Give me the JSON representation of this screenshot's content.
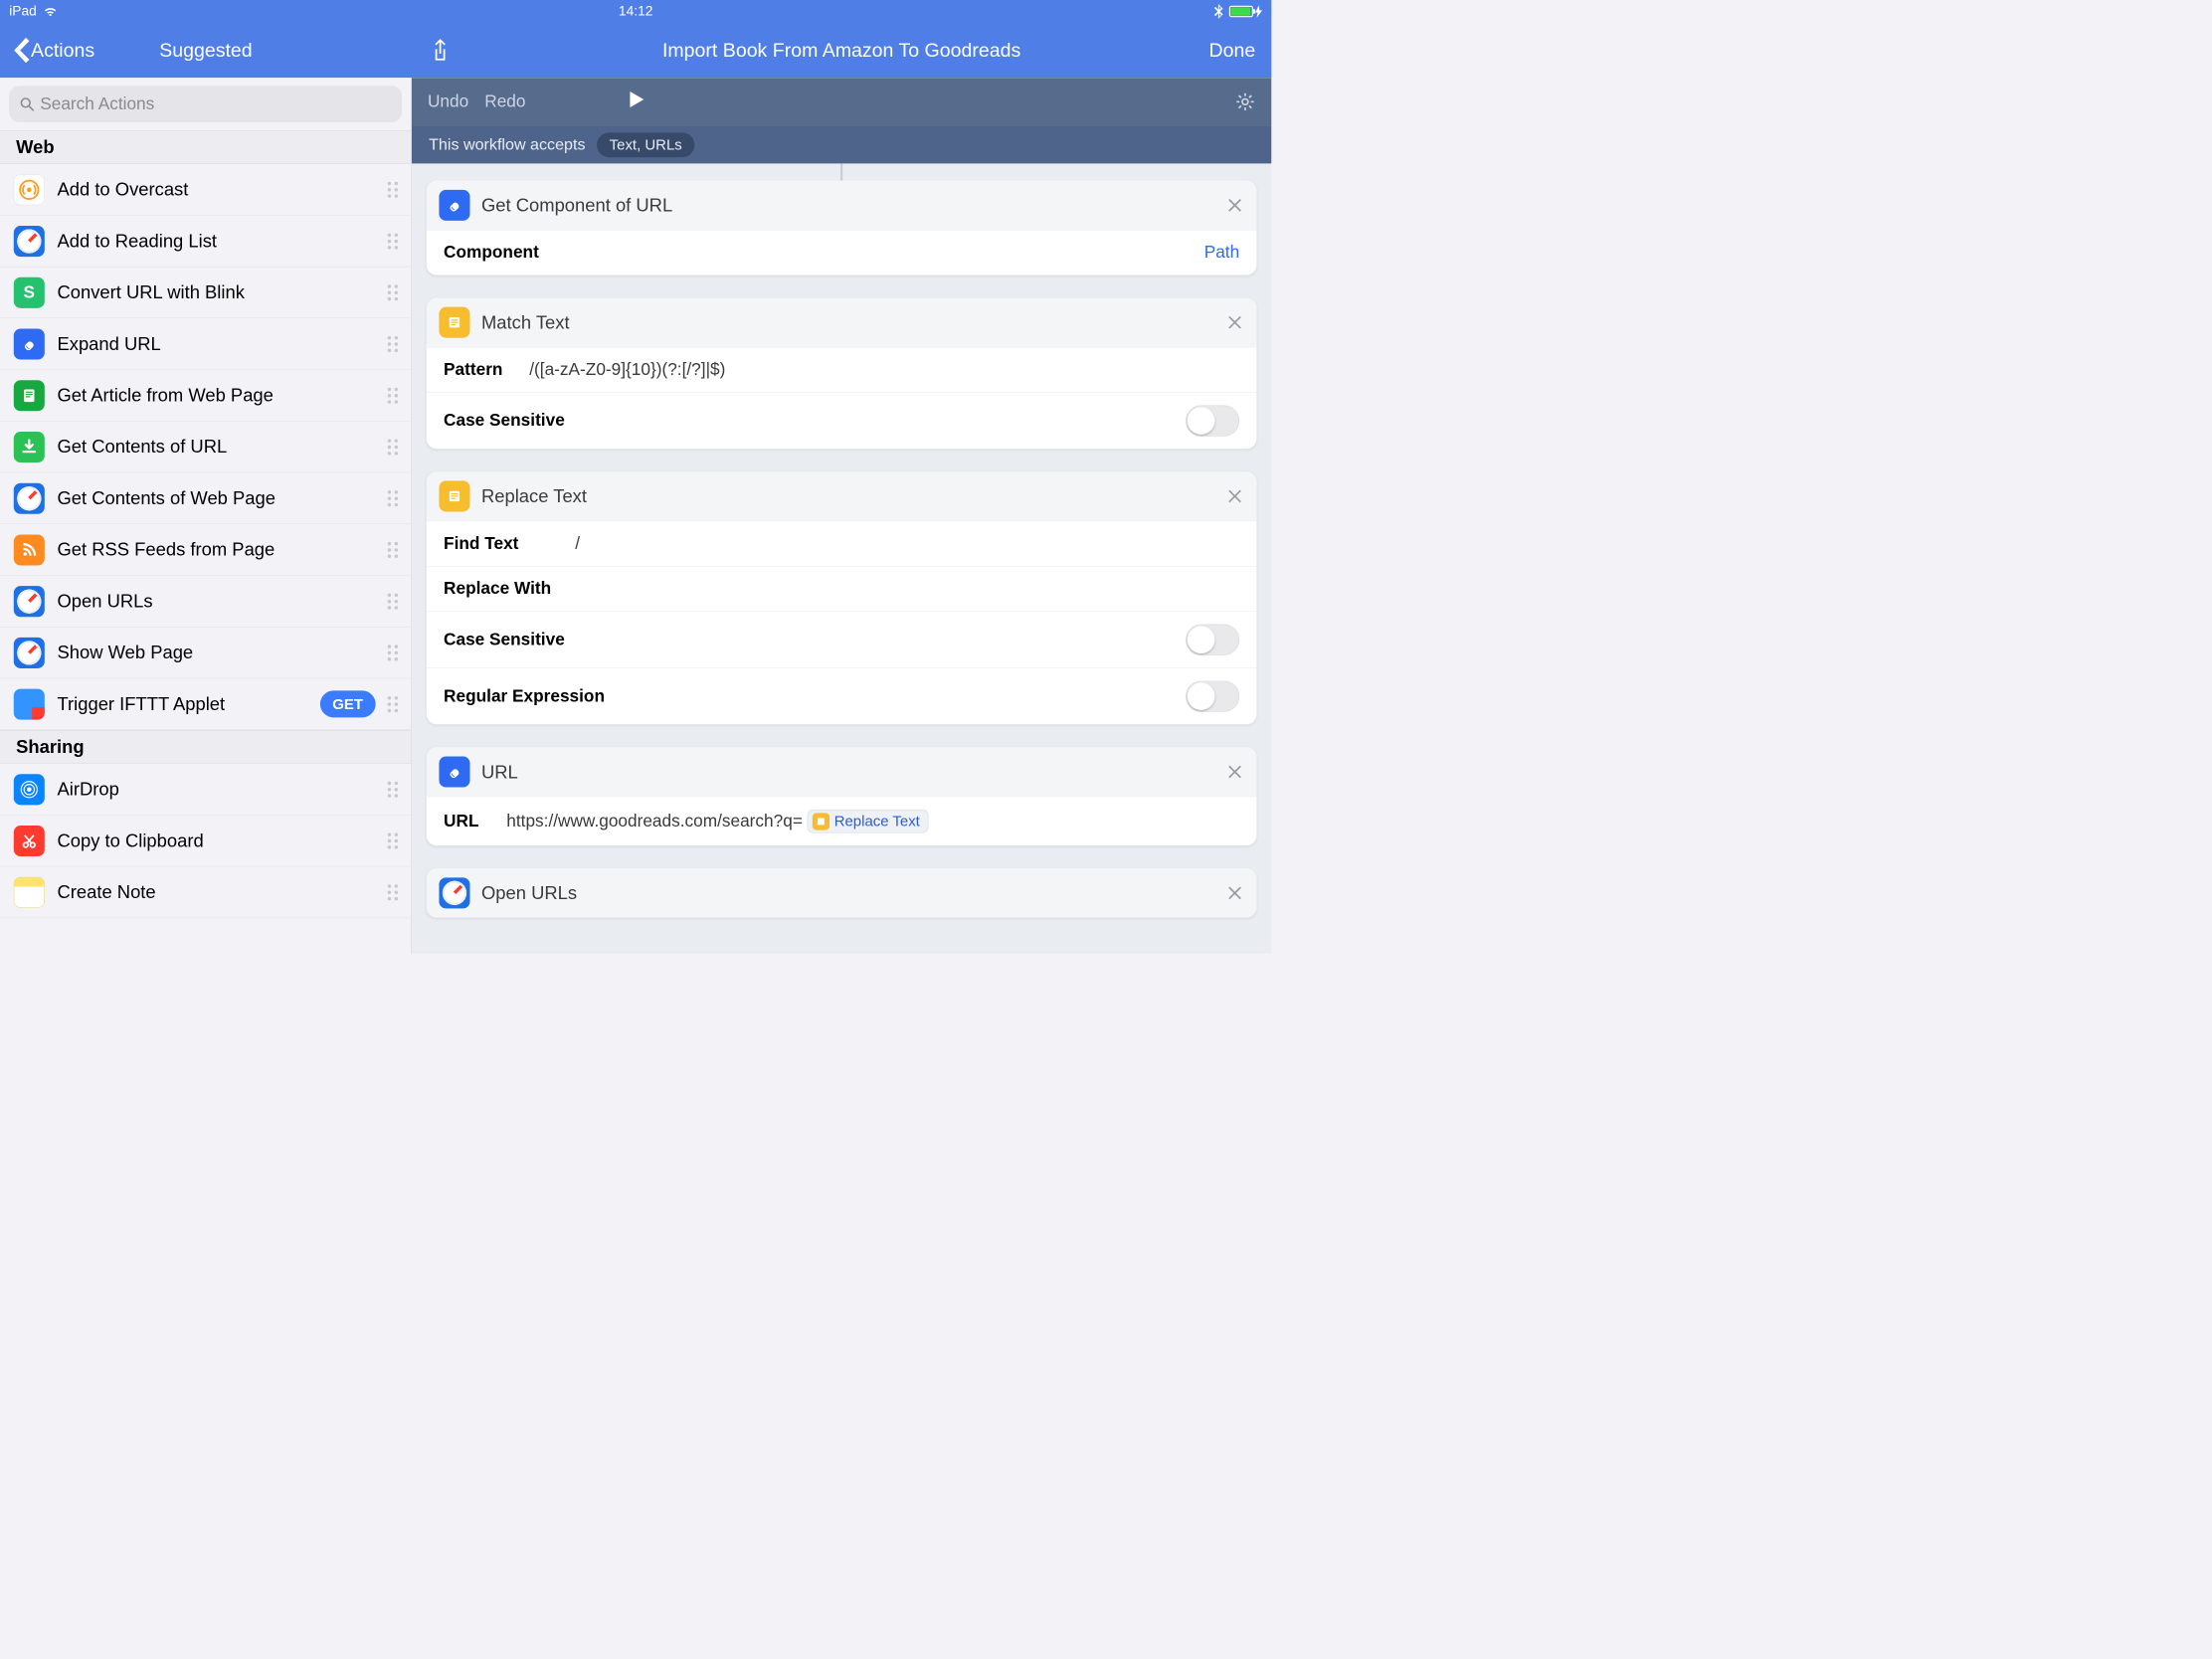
{
  "status": {
    "device": "iPad",
    "time": "14:12"
  },
  "nav": {
    "back_label": "Actions",
    "left_title": "Suggested",
    "center_title": "Import Book From Amazon To Goodreads",
    "done_label": "Done"
  },
  "search": {
    "placeholder": "Search Actions"
  },
  "sections": {
    "web": "Web",
    "sharing": "Sharing"
  },
  "actions": {
    "overcast": "Add to Overcast",
    "reading_list": "Add to Reading List",
    "blink": "Convert URL with Blink",
    "expand_url": "Expand URL",
    "article": "Get Article from Web Page",
    "contents_url": "Get Contents of URL",
    "contents_page": "Get Contents of Web Page",
    "rss": "Get RSS Feeds from Page",
    "open_urls": "Open URLs",
    "show_page": "Show Web Page",
    "ifttt": "Trigger IFTTT Applet",
    "ifttt_badge": "GET",
    "airdrop": "AirDrop",
    "clipboard": "Copy to Clipboard",
    "create_note": "Create Note"
  },
  "editor": {
    "undo": "Undo",
    "redo": "Redo",
    "accepts_label": "This workflow accepts",
    "accepts_value": "Text, URLs"
  },
  "cards": {
    "get_component": {
      "title": "Get Component of URL",
      "param_label": "Component",
      "param_value": "Path"
    },
    "match_text": {
      "title": "Match Text",
      "pattern_label": "Pattern",
      "pattern_value": "/([a-zA-Z0-9]{10})(?:[/?]|$)",
      "case_label": "Case Sensitive"
    },
    "replace_text": {
      "title": "Replace Text",
      "find_label": "Find Text",
      "find_value": "/",
      "replace_label": "Replace With",
      "case_label": "Case Sensitive",
      "regex_label": "Regular Expression"
    },
    "url": {
      "title": "URL",
      "url_label": "URL",
      "url_value": "https://www.goodreads.com/search?q=",
      "token_label": "Replace Text"
    },
    "open_urls": {
      "title": "Open URLs"
    }
  }
}
